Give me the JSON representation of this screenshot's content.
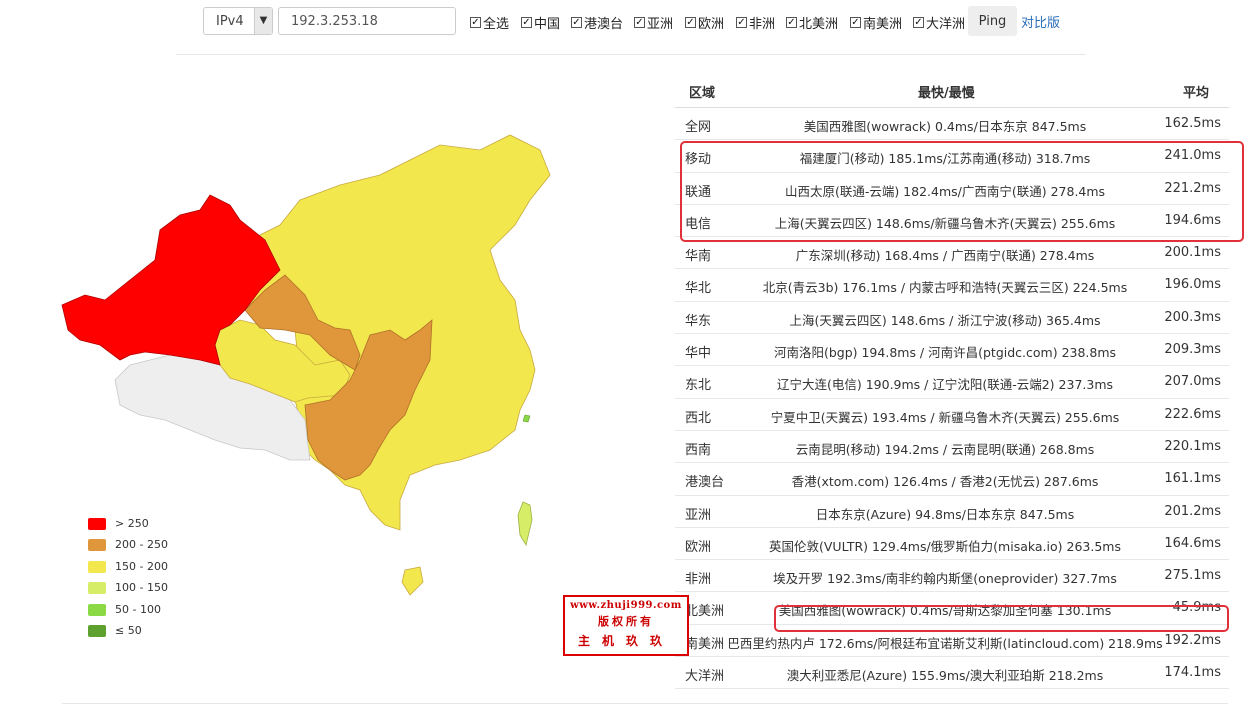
{
  "toolbar": {
    "ip_version": "IPv4",
    "ip_address": "192.3.253.18",
    "checkboxes": [
      {
        "label": "全选",
        "checked": true
      },
      {
        "label": "中国",
        "checked": true
      },
      {
        "label": "港澳台",
        "checked": true
      },
      {
        "label": "亚洲",
        "checked": true
      },
      {
        "label": "欧洲",
        "checked": true
      },
      {
        "label": "非洲",
        "checked": true
      },
      {
        "label": "北美洲",
        "checked": true
      },
      {
        "label": "南美洲",
        "checked": true
      },
      {
        "label": "大洋洲",
        "checked": true
      }
    ],
    "ping_label": "Ping",
    "compare_label": "对比版"
  },
  "legend": [
    {
      "label": "> 250",
      "color": "#ff0000"
    },
    {
      "label": "200 - 250",
      "color": "#e0963a"
    },
    {
      "label": "150 - 200",
      "color": "#f2e84e"
    },
    {
      "label": "100 - 150",
      "color": "#d6ed68"
    },
    {
      "label": "50 - 100",
      "color": "#8cd946"
    },
    {
      "label": "≤ 50",
      "color": "#5ea12e"
    }
  ],
  "watermark": {
    "url": "www.zhuji999.com",
    "line1": "版权所有",
    "line2": "主机玖玖"
  },
  "table": {
    "headers": [
      "区域",
      "最快/最慢",
      "平均"
    ],
    "rows": [
      [
        "全网",
        "美国西雅图(wowrack) 0.4ms/日本东京 847.5ms",
        "162.5ms"
      ],
      [
        "移动",
        "福建厦门(移动) 185.1ms/江苏南通(移动) 318.7ms",
        "241.0ms"
      ],
      [
        "联通",
        "山西太原(联通-云端) 182.4ms/广西南宁(联通) 278.4ms",
        "221.2ms"
      ],
      [
        "电信",
        "上海(天翼云四区) 148.6ms/新疆乌鲁木齐(天翼云) 255.6ms",
        "194.6ms"
      ],
      [
        "华南",
        "广东深圳(移动) 168.4ms / 广西南宁(联通) 278.4ms",
        "200.1ms"
      ],
      [
        "华北",
        "北京(青云3b) 176.1ms / 内蒙古呼和浩特(天翼云三区) 224.5ms",
        "196.0ms"
      ],
      [
        "华东",
        "上海(天翼云四区) 148.6ms / 浙江宁波(移动) 365.4ms",
        "200.3ms"
      ],
      [
        "华中",
        "河南洛阳(bgp) 194.8ms / 河南许昌(ptgidc.com) 238.8ms",
        "209.3ms"
      ],
      [
        "东北",
        "辽宁大连(电信) 190.9ms / 辽宁沈阳(联通-云端2) 237.3ms",
        "207.0ms"
      ],
      [
        "西北",
        "宁夏中卫(天翼云) 193.4ms / 新疆乌鲁木齐(天翼云) 255.6ms",
        "222.6ms"
      ],
      [
        "西南",
        "云南昆明(移动) 194.2ms / 云南昆明(联通) 268.8ms",
        "220.1ms"
      ],
      [
        "港澳台",
        "香港(xtom.com) 126.4ms / 香港2(无忧云) 287.6ms",
        "161.1ms"
      ],
      [
        "亚洲",
        "日本东京(Azure) 94.8ms/日本东京 847.5ms",
        "201.2ms"
      ],
      [
        "欧洲",
        "英国伦敦(VULTR) 129.4ms/俄罗斯伯力(misaka.io) 263.5ms",
        "164.6ms"
      ],
      [
        "非洲",
        "埃及开罗 192.3ms/南非约翰内斯堡(oneprovider) 327.7ms",
        "275.1ms"
      ],
      [
        "北美洲",
        "美国西雅图(wowrack) 0.4ms/哥斯达黎加圣何塞 130.1ms",
        "45.9ms"
      ],
      [
        "南美洲",
        "巴西里约热内卢 172.6ms/阿根廷布宜诺斯艾利斯(latincloud.com) 218.9ms",
        "192.2ms"
      ],
      [
        "大洋洲",
        "澳大利亚悉尼(Azure) 155.9ms/澳大利亚珀斯 218.2ms",
        "174.1ms"
      ]
    ]
  }
}
